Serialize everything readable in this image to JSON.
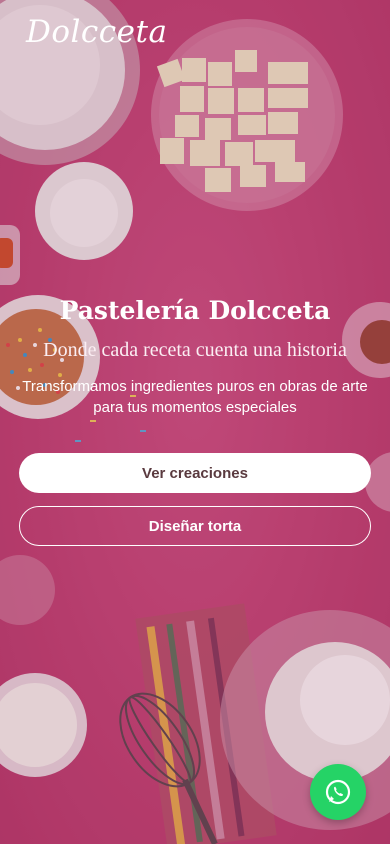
{
  "brand": {
    "logo": "Dolcceta"
  },
  "hero": {
    "title": "Pastelería Dolcceta",
    "subtitle": "Donde cada receta cuenta una historia",
    "description": "Transformamos ingredientes puros en obras de arte para tus momentos especiales"
  },
  "actions": {
    "primary_label": "Ver creaciones",
    "secondary_label": "Diseñar torta"
  },
  "floating": {
    "icon": "whatsapp-icon"
  },
  "colors": {
    "background": "#c8487a",
    "primary_button_bg": "#ffffff",
    "primary_button_text": "#5a3a3f",
    "whatsapp": "#25d366"
  }
}
